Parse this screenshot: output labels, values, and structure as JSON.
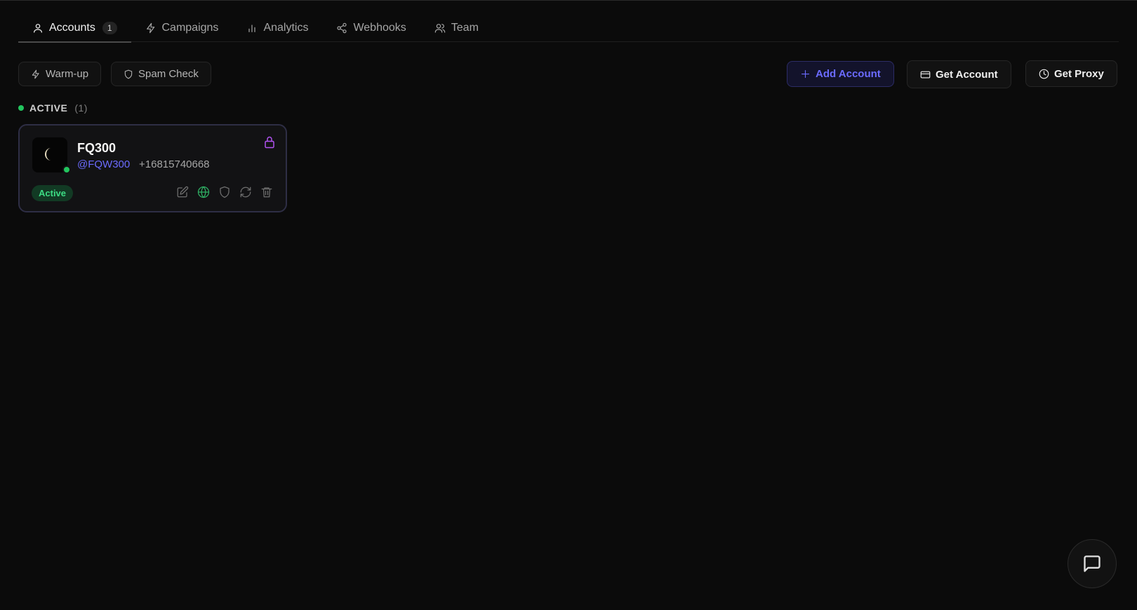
{
  "tabs": [
    {
      "label": "Accounts",
      "count": "1",
      "icon": "user-icon",
      "active": true
    },
    {
      "label": "Campaigns",
      "icon": "lightning-icon"
    },
    {
      "label": "Analytics",
      "icon": "bar-chart-icon"
    },
    {
      "label": "Webhooks",
      "icon": "share-nodes-icon"
    },
    {
      "label": "Team",
      "icon": "users-icon"
    }
  ],
  "toolbar": {
    "warmup_label": "Warm-up",
    "spam_check_label": "Spam Check",
    "add_account_label": "Add Account",
    "get_account_label": "Get Account",
    "get_proxy_label": "Get Proxy"
  },
  "section": {
    "label": "ACTIVE",
    "count": "(1)"
  },
  "account": {
    "name": "FQ300",
    "handle": "@FQW300",
    "phone": "+16815740668",
    "status": "Active"
  },
  "colors": {
    "accent": "#6b6bff",
    "online": "#22c55e",
    "lock": "#b052f0",
    "badge_bg": "#123a24",
    "badge_text": "#3ddc84"
  }
}
